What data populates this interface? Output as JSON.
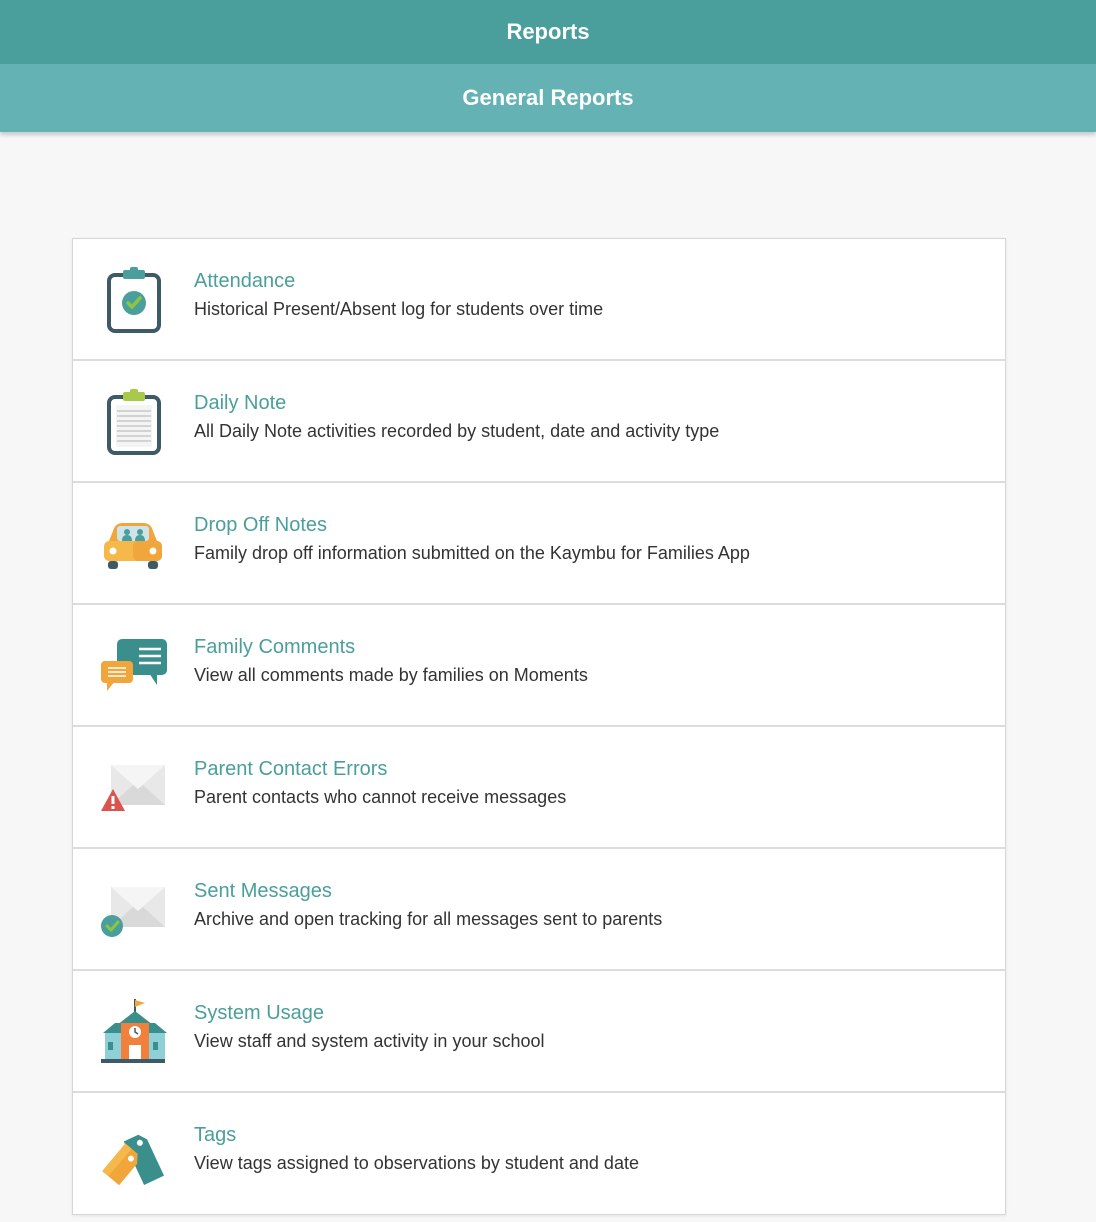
{
  "header": {
    "title": "Reports"
  },
  "subheader": {
    "title": "General Reports"
  },
  "reports": [
    {
      "title": "Attendance",
      "description": "Historical Present/Absent log for students over time",
      "icon": "clipboard-check-icon"
    },
    {
      "title": "Daily Note",
      "description": "All Daily Note activities recorded by student, date and activity type",
      "icon": "clipboard-note-icon"
    },
    {
      "title": "Drop Off Notes",
      "description": "Family drop off information submitted on the Kaymbu for Families App",
      "icon": "car-icon"
    },
    {
      "title": "Family Comments",
      "description": "View all comments made by families on Moments",
      "icon": "chat-bubbles-icon"
    },
    {
      "title": "Parent Contact Errors",
      "description": "Parent contacts who cannot receive messages",
      "icon": "envelope-warning-icon"
    },
    {
      "title": "Sent Messages",
      "description": "Archive and open tracking for all messages sent to parents",
      "icon": "envelope-check-icon"
    },
    {
      "title": "System Usage",
      "description": "View staff and system activity in your school",
      "icon": "school-building-icon"
    },
    {
      "title": "Tags",
      "description": "View tags assigned to observations by student and date",
      "icon": "tags-icon"
    }
  ],
  "colors": {
    "header_bg": "#4a9f9c",
    "subheader_bg": "#64b2b3",
    "link_teal": "#4a9f9c",
    "accent_orange": "#f0a63a",
    "accent_green": "#8cc63f",
    "warning_red": "#d9534f"
  }
}
